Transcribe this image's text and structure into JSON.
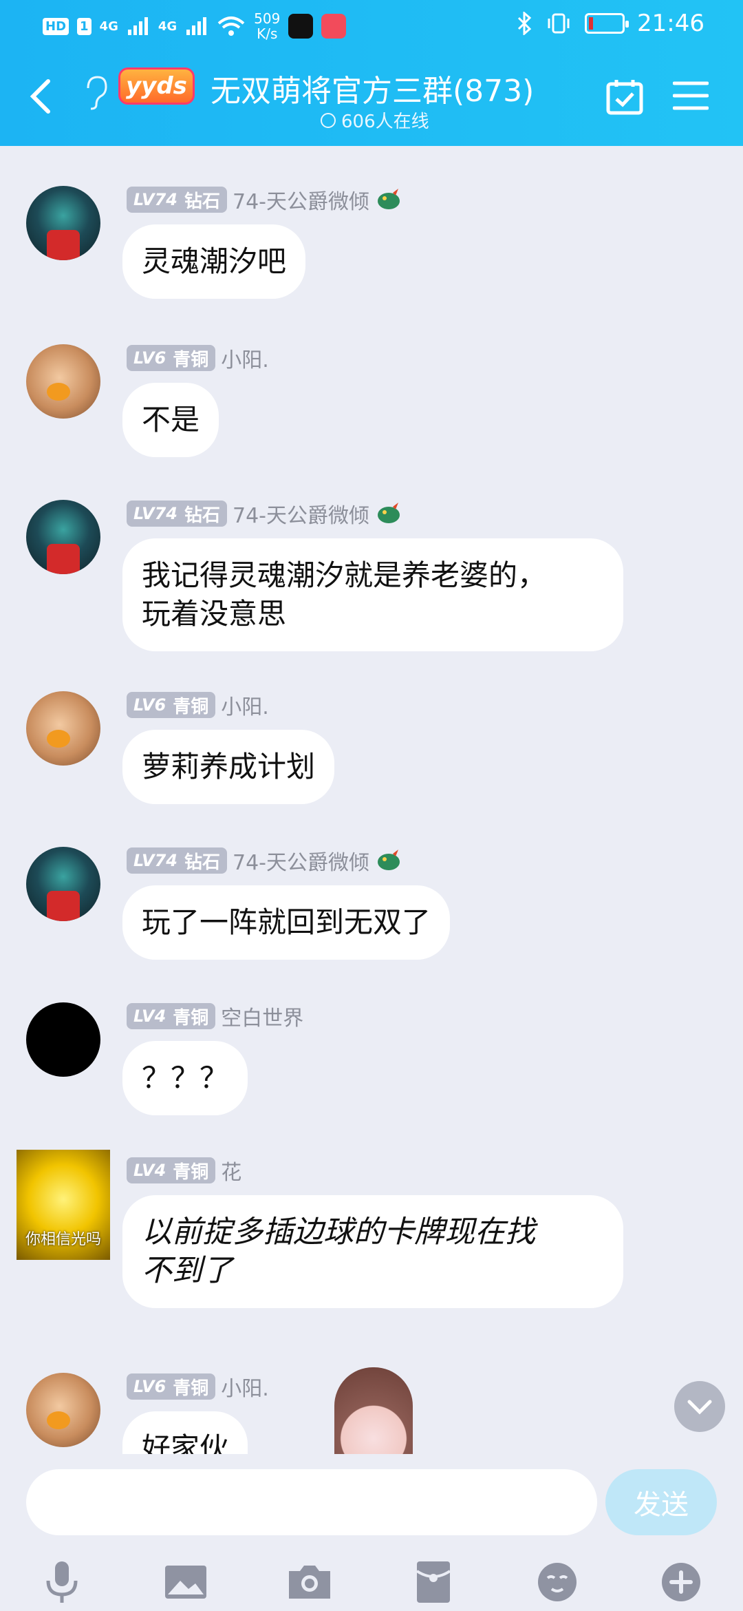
{
  "status_bar": {
    "hd": "HD",
    "sim": "1",
    "sig1": "4G",
    "sig2": "4G",
    "net_speed_value": "509",
    "net_speed_unit": "K/s",
    "time": "21:46"
  },
  "header": {
    "badge": "yyds",
    "title": "无双萌将官方三群(873)",
    "online": "606人在线"
  },
  "messages": [
    {
      "level": "LV74",
      "rank": "钻石",
      "nick": "74-天公爵微倾",
      "text": "灵魂潮汐吧"
    },
    {
      "level": "LV6",
      "rank": "青铜",
      "nick": "小阳.",
      "text": "不是"
    },
    {
      "level": "LV74",
      "rank": "钻石",
      "nick": "74-天公爵微倾",
      "text_line1": "我记得灵魂潮汐就是养老婆的，",
      "text_line2": "玩着没意思"
    },
    {
      "level": "LV6",
      "rank": "青铜",
      "nick": "小阳.",
      "text": "萝莉养成计划"
    },
    {
      "level": "LV74",
      "rank": "钻石",
      "nick": "74-天公爵微倾",
      "text": "玩了一阵就回到无双了"
    },
    {
      "level": "LV4",
      "rank": "青铜",
      "nick": "空白世界",
      "text": "？？？"
    },
    {
      "level": "LV4",
      "rank": "青铜",
      "nick": "花",
      "avatar_caption": "你相信光吗",
      "text_line1": "以前掟多插边球的卡牌现在找",
      "text_line2": "不到了"
    },
    {
      "level": "LV6",
      "rank": "青铜",
      "nick": "小阳.",
      "text": "好家伙"
    }
  ],
  "input": {
    "placeholder": "",
    "send_label": "发送"
  },
  "colors": {
    "header": "#1cb4f3",
    "background": "#ebedf5",
    "send_disabled": "#bfe7f8"
  }
}
